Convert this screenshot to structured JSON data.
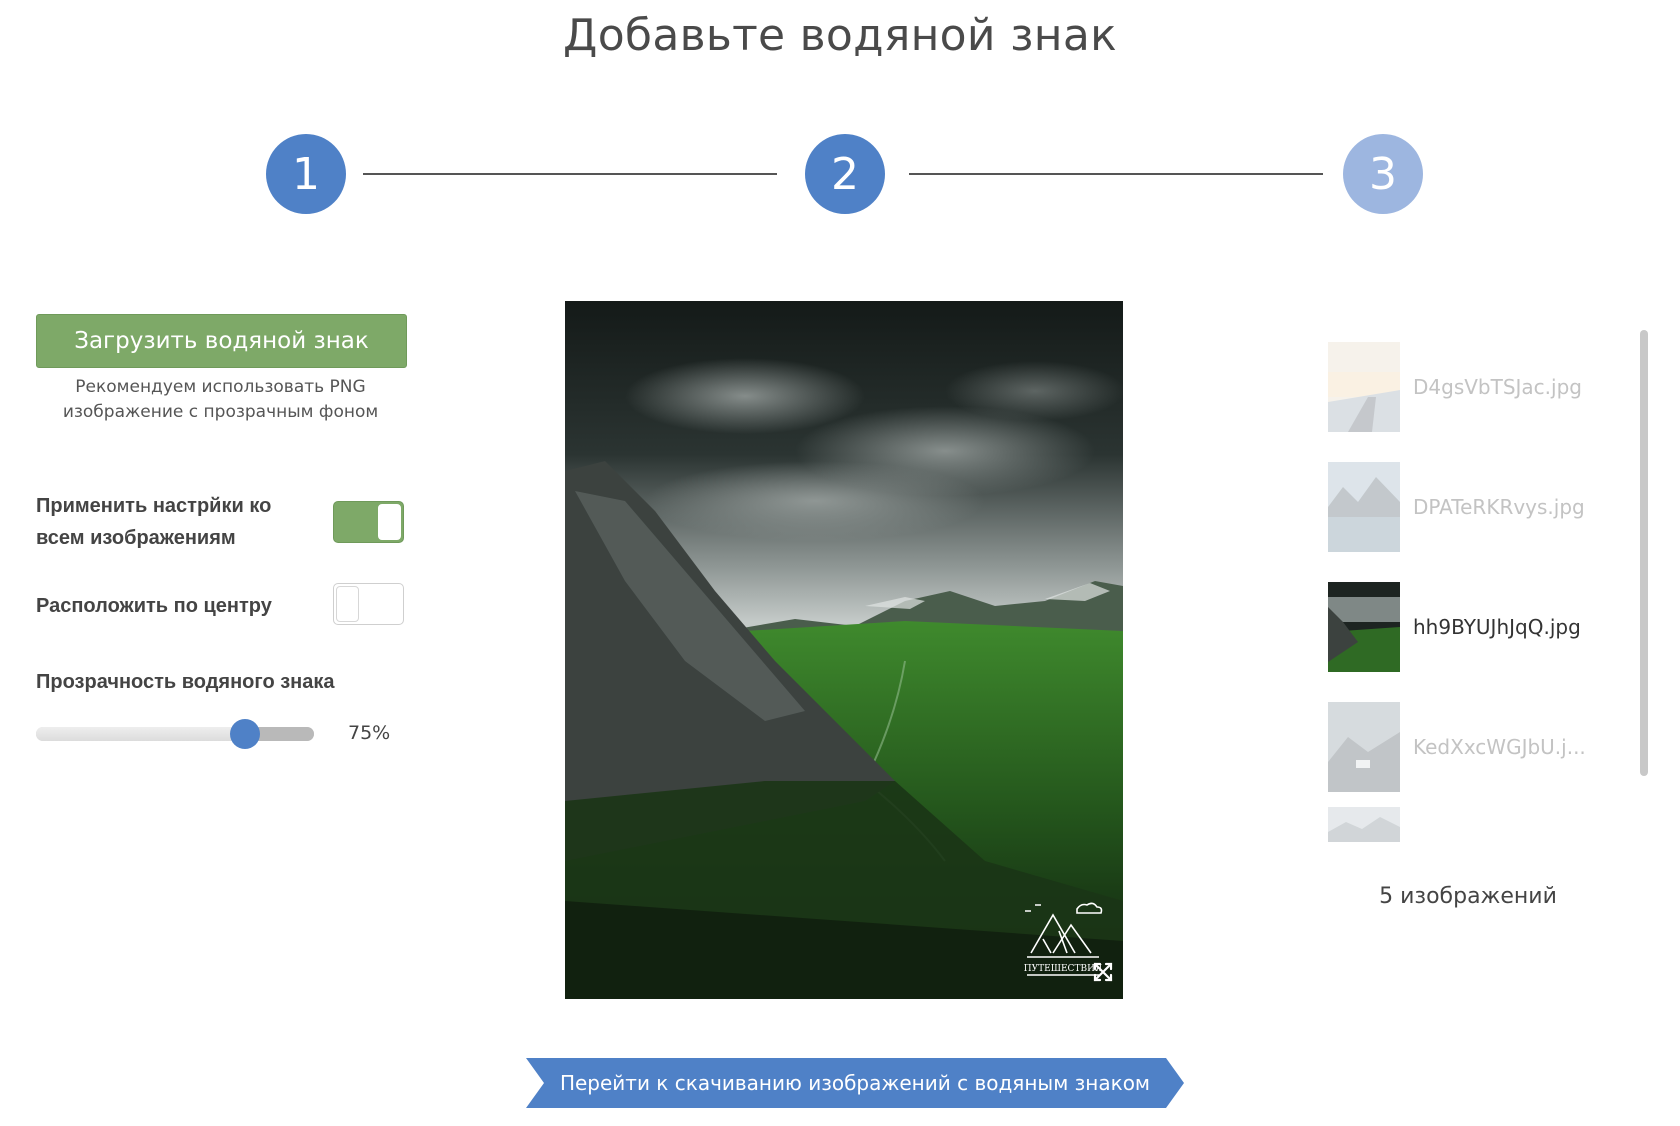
{
  "page": {
    "title": "Добавьте водяной знак"
  },
  "stepper": {
    "steps": [
      {
        "label": "1",
        "state": "done"
      },
      {
        "label": "2",
        "state": "current"
      },
      {
        "label": "3",
        "state": "pending"
      }
    ],
    "colors": {
      "active": "#4f81c7",
      "inactive": "#9db6e0"
    }
  },
  "left_panel": {
    "upload_button": "Загрузить водяной знак",
    "hint_line1": "Рекомендуем использовать PNG",
    "hint_line2": "изображение с прозрачным фоном",
    "apply_all": {
      "label_line1": "Применить настрйки ко",
      "label_line2": "всем изображениям",
      "on": true
    },
    "center": {
      "label": "Расположить по центру",
      "on": false
    },
    "opacity": {
      "label": "Прозрачность водяного знака",
      "value": 75,
      "display": "75%"
    }
  },
  "preview": {
    "watermark_text": "ПУТЕШЕСТВИЯ",
    "resize_icon": "resize-arrows-icon"
  },
  "thumbnails": {
    "items": [
      {
        "name": "D4gsVbTSJac.jpg",
        "active": false
      },
      {
        "name": "DPATeRKRvys.jpg",
        "active": false
      },
      {
        "name": "hh9BYUJhJqQ.jpg",
        "active": true
      },
      {
        "name": "KedXxcWGJbU.j...",
        "active": false
      },
      {
        "name": "",
        "active": false
      }
    ],
    "count_label": "5 изображений"
  },
  "next_button": {
    "label": "Перейти к скачиванию изображений с водяным знаком"
  },
  "colors": {
    "accent": "#4f81c7",
    "green": "#7ea968"
  }
}
